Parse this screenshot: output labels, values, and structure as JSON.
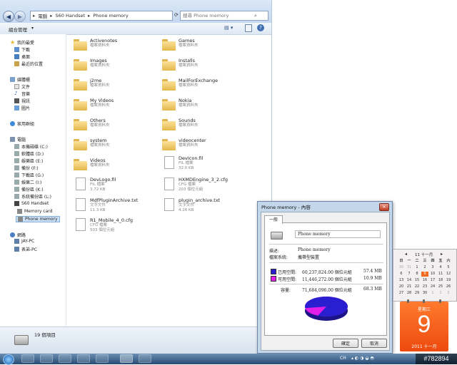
{
  "explorer": {
    "breadcrumb": [
      "電腦",
      "S60 Handset",
      "Phone memory"
    ],
    "search_placeholder": "搜尋 Phone memory",
    "toolbar": {
      "organize": "組合管理"
    },
    "sidebar": {
      "favorites": "我的最愛",
      "downloads": "下載",
      "desktop": "桌面",
      "recent": "最近的位置",
      "libraries": "媒體櫃",
      "documents": "文件",
      "music": "音樂",
      "videos": "視訊",
      "pictures": "圖片",
      "homegroup": "家用群組",
      "computer": "電腦",
      "drives": [
        "本機磁碟 (C:)",
        "軟體區 (D:)",
        "娛樂區 (E:)",
        "備份 (F:)",
        "下載區 (G:)",
        "娛樂二 (I:)",
        "備份區 (K:)",
        "系統備份區 (L:)",
        "S60 Handset",
        "Memory card",
        "Phone memory"
      ],
      "network": "網路",
      "hosts": [
        "JAY-PC",
        "表弟-PC"
      ]
    },
    "files": [
      {
        "name": "Activenotes",
        "sub": "檔案資料夾",
        "type": "folder"
      },
      {
        "name": "Games",
        "sub": "檔案資料夾",
        "type": "folder"
      },
      {
        "name": "Images",
        "sub": "檔案資料夾",
        "type": "folder"
      },
      {
        "name": "Installs",
        "sub": "檔案資料夾",
        "type": "folder"
      },
      {
        "name": "j2me",
        "sub": "檔案資料夾",
        "type": "folder"
      },
      {
        "name": "MailForExchange",
        "sub": "檔案資料夾",
        "type": "folder"
      },
      {
        "name": "My Videos",
        "sub": "檔案資料夾",
        "type": "folder"
      },
      {
        "name": "Nokia",
        "sub": "檔案資料夾",
        "type": "folder"
      },
      {
        "name": "Others",
        "sub": "檔案資料夾",
        "type": "folder"
      },
      {
        "name": "Sounds",
        "sub": "檔案資料夾",
        "type": "folder"
      },
      {
        "name": "system",
        "sub": "檔案資料夾",
        "type": "folder"
      },
      {
        "name": "videocenter",
        "sub": "檔案資料夾",
        "type": "folder"
      },
      {
        "name": "Videos",
        "sub": "檔案資料夾",
        "type": "folder"
      },
      {
        "name": "DevIcon.fil",
        "sub": "FIL 檔案",
        "size": "32.0 KB",
        "type": "doc"
      },
      {
        "name": "DevLogo.fil",
        "sub": "FIL 檔案",
        "size": "3.72 KB",
        "type": "doc"
      },
      {
        "name": "HXMDEngine_3_2.cfg",
        "sub": "CFG 檔案",
        "size": "203 個位元組",
        "type": "doc"
      },
      {
        "name": "MdfPluginArchive.txt",
        "sub": "文字文件",
        "size": "11.3 KB",
        "type": "doc"
      },
      {
        "name": "plugin_archive.txt",
        "sub": "文字文件",
        "size": "4.26 KB",
        "type": "doc"
      },
      {
        "name": "R1_Mobile_4_0.cfg",
        "sub": "CFG 檔案",
        "size": "503 個位元組",
        "type": "doc"
      }
    ],
    "status": "19 個項目"
  },
  "dialog": {
    "title": "Phone memory - 內容",
    "tab": "一般",
    "name_value": "Phone memory",
    "desc_label": "描述:",
    "desc_value": "Phone memory",
    "fs_label": "檔案系統:",
    "fs_value": "攜帶型裝置",
    "used_label": "已用空間:",
    "used_bytes": "60,237,824.00 個位元組",
    "used_mb": "57.4 MB",
    "free_label": "可用空間:",
    "free_bytes": "11,446,272.00 個位元組",
    "free_mb": "10.9 MB",
    "cap_label": "容量:",
    "cap_bytes": "71,684,096.00 個位元組",
    "cap_mb": "68.3 MB",
    "ok": "確定",
    "cancel": "取消",
    "colors": {
      "used": "#2a1fd0",
      "free": "#e31ee8"
    },
    "used_fraction": 0.84
  },
  "calendar": {
    "month_header": "11 十一月",
    "weekdays": [
      "日",
      "一",
      "二",
      "三",
      "四",
      "五",
      "六"
    ],
    "weeks": [
      [
        "30",
        "31",
        "1",
        "2",
        "3",
        "4",
        "5"
      ],
      [
        "6",
        "7",
        "8",
        "9",
        "10",
        "11",
        "12"
      ],
      [
        "13",
        "14",
        "15",
        "16",
        "17",
        "18",
        "19"
      ],
      [
        "20",
        "21",
        "22",
        "23",
        "24",
        "25",
        "26"
      ],
      [
        "27",
        "28",
        "29",
        "30",
        "1",
        "2",
        "3"
      ]
    ],
    "weekday_label": "星期三",
    "day": "9",
    "month_label": "2011 十一月"
  },
  "taskbar": {
    "lang": "CH",
    "watermark": "#782894"
  }
}
